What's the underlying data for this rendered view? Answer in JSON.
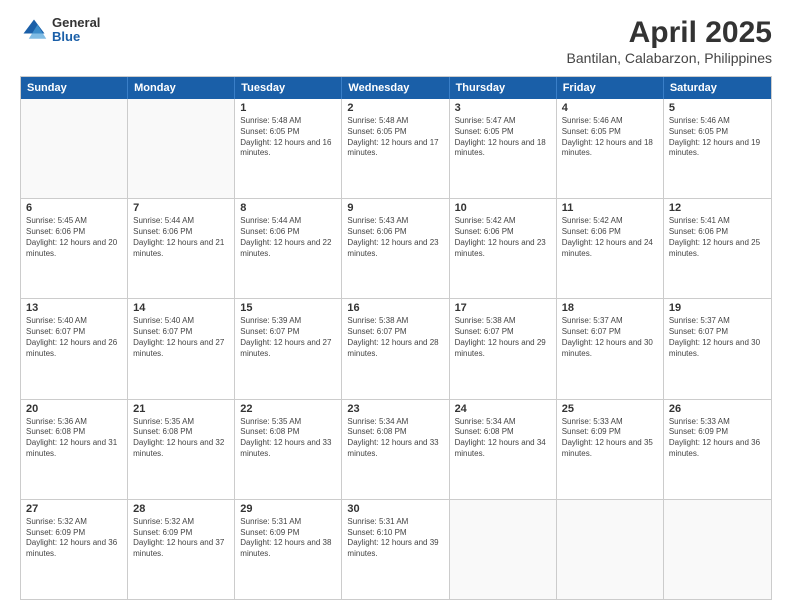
{
  "header": {
    "logo": {
      "general": "General",
      "blue": "Blue"
    },
    "title": "April 2025",
    "subtitle": "Bantilan, Calabarzon, Philippines"
  },
  "calendar": {
    "days": [
      "Sunday",
      "Monday",
      "Tuesday",
      "Wednesday",
      "Thursday",
      "Friday",
      "Saturday"
    ],
    "weeks": [
      [
        {
          "date": "",
          "sunrise": "",
          "sunset": "",
          "daylight": ""
        },
        {
          "date": "",
          "sunrise": "",
          "sunset": "",
          "daylight": ""
        },
        {
          "date": "1",
          "sunrise": "Sunrise: 5:48 AM",
          "sunset": "Sunset: 6:05 PM",
          "daylight": "Daylight: 12 hours and 16 minutes."
        },
        {
          "date": "2",
          "sunrise": "Sunrise: 5:48 AM",
          "sunset": "Sunset: 6:05 PM",
          "daylight": "Daylight: 12 hours and 17 minutes."
        },
        {
          "date": "3",
          "sunrise": "Sunrise: 5:47 AM",
          "sunset": "Sunset: 6:05 PM",
          "daylight": "Daylight: 12 hours and 18 minutes."
        },
        {
          "date": "4",
          "sunrise": "Sunrise: 5:46 AM",
          "sunset": "Sunset: 6:05 PM",
          "daylight": "Daylight: 12 hours and 18 minutes."
        },
        {
          "date": "5",
          "sunrise": "Sunrise: 5:46 AM",
          "sunset": "Sunset: 6:05 PM",
          "daylight": "Daylight: 12 hours and 19 minutes."
        }
      ],
      [
        {
          "date": "6",
          "sunrise": "Sunrise: 5:45 AM",
          "sunset": "Sunset: 6:06 PM",
          "daylight": "Daylight: 12 hours and 20 minutes."
        },
        {
          "date": "7",
          "sunrise": "Sunrise: 5:44 AM",
          "sunset": "Sunset: 6:06 PM",
          "daylight": "Daylight: 12 hours and 21 minutes."
        },
        {
          "date": "8",
          "sunrise": "Sunrise: 5:44 AM",
          "sunset": "Sunset: 6:06 PM",
          "daylight": "Daylight: 12 hours and 22 minutes."
        },
        {
          "date": "9",
          "sunrise": "Sunrise: 5:43 AM",
          "sunset": "Sunset: 6:06 PM",
          "daylight": "Daylight: 12 hours and 23 minutes."
        },
        {
          "date": "10",
          "sunrise": "Sunrise: 5:42 AM",
          "sunset": "Sunset: 6:06 PM",
          "daylight": "Daylight: 12 hours and 23 minutes."
        },
        {
          "date": "11",
          "sunrise": "Sunrise: 5:42 AM",
          "sunset": "Sunset: 6:06 PM",
          "daylight": "Daylight: 12 hours and 24 minutes."
        },
        {
          "date": "12",
          "sunrise": "Sunrise: 5:41 AM",
          "sunset": "Sunset: 6:06 PM",
          "daylight": "Daylight: 12 hours and 25 minutes."
        }
      ],
      [
        {
          "date": "13",
          "sunrise": "Sunrise: 5:40 AM",
          "sunset": "Sunset: 6:07 PM",
          "daylight": "Daylight: 12 hours and 26 minutes."
        },
        {
          "date": "14",
          "sunrise": "Sunrise: 5:40 AM",
          "sunset": "Sunset: 6:07 PM",
          "daylight": "Daylight: 12 hours and 27 minutes."
        },
        {
          "date": "15",
          "sunrise": "Sunrise: 5:39 AM",
          "sunset": "Sunset: 6:07 PM",
          "daylight": "Daylight: 12 hours and 27 minutes."
        },
        {
          "date": "16",
          "sunrise": "Sunrise: 5:38 AM",
          "sunset": "Sunset: 6:07 PM",
          "daylight": "Daylight: 12 hours and 28 minutes."
        },
        {
          "date": "17",
          "sunrise": "Sunrise: 5:38 AM",
          "sunset": "Sunset: 6:07 PM",
          "daylight": "Daylight: 12 hours and 29 minutes."
        },
        {
          "date": "18",
          "sunrise": "Sunrise: 5:37 AM",
          "sunset": "Sunset: 6:07 PM",
          "daylight": "Daylight: 12 hours and 30 minutes."
        },
        {
          "date": "19",
          "sunrise": "Sunrise: 5:37 AM",
          "sunset": "Sunset: 6:07 PM",
          "daylight": "Daylight: 12 hours and 30 minutes."
        }
      ],
      [
        {
          "date": "20",
          "sunrise": "Sunrise: 5:36 AM",
          "sunset": "Sunset: 6:08 PM",
          "daylight": "Daylight: 12 hours and 31 minutes."
        },
        {
          "date": "21",
          "sunrise": "Sunrise: 5:35 AM",
          "sunset": "Sunset: 6:08 PM",
          "daylight": "Daylight: 12 hours and 32 minutes."
        },
        {
          "date": "22",
          "sunrise": "Sunrise: 5:35 AM",
          "sunset": "Sunset: 6:08 PM",
          "daylight": "Daylight: 12 hours and 33 minutes."
        },
        {
          "date": "23",
          "sunrise": "Sunrise: 5:34 AM",
          "sunset": "Sunset: 6:08 PM",
          "daylight": "Daylight: 12 hours and 33 minutes."
        },
        {
          "date": "24",
          "sunrise": "Sunrise: 5:34 AM",
          "sunset": "Sunset: 6:08 PM",
          "daylight": "Daylight: 12 hours and 34 minutes."
        },
        {
          "date": "25",
          "sunrise": "Sunrise: 5:33 AM",
          "sunset": "Sunset: 6:09 PM",
          "daylight": "Daylight: 12 hours and 35 minutes."
        },
        {
          "date": "26",
          "sunrise": "Sunrise: 5:33 AM",
          "sunset": "Sunset: 6:09 PM",
          "daylight": "Daylight: 12 hours and 36 minutes."
        }
      ],
      [
        {
          "date": "27",
          "sunrise": "Sunrise: 5:32 AM",
          "sunset": "Sunset: 6:09 PM",
          "daylight": "Daylight: 12 hours and 36 minutes."
        },
        {
          "date": "28",
          "sunrise": "Sunrise: 5:32 AM",
          "sunset": "Sunset: 6:09 PM",
          "daylight": "Daylight: 12 hours and 37 minutes."
        },
        {
          "date": "29",
          "sunrise": "Sunrise: 5:31 AM",
          "sunset": "Sunset: 6:09 PM",
          "daylight": "Daylight: 12 hours and 38 minutes."
        },
        {
          "date": "30",
          "sunrise": "Sunrise: 5:31 AM",
          "sunset": "Sunset: 6:10 PM",
          "daylight": "Daylight: 12 hours and 39 minutes."
        },
        {
          "date": "",
          "sunrise": "",
          "sunset": "",
          "daylight": ""
        },
        {
          "date": "",
          "sunrise": "",
          "sunset": "",
          "daylight": ""
        },
        {
          "date": "",
          "sunrise": "",
          "sunset": "",
          "daylight": ""
        }
      ]
    ]
  }
}
